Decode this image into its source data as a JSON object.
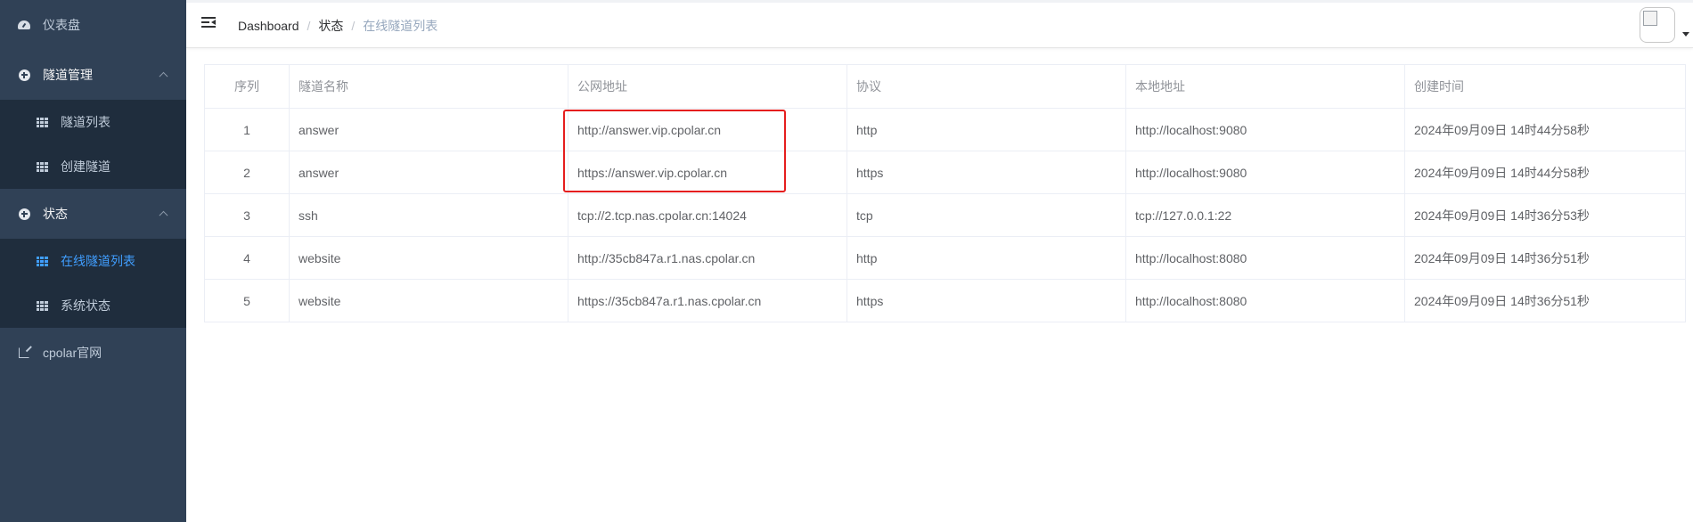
{
  "sidebar": {
    "items": [
      {
        "label": "仪表盘",
        "icon": "dashboard-icon"
      },
      {
        "label": "隧道管理",
        "icon": "tunnel-icon",
        "children": [
          {
            "label": "隧道列表",
            "icon": "table-icon"
          },
          {
            "label": "创建隧道",
            "icon": "table-icon"
          }
        ]
      },
      {
        "label": "状态",
        "icon": "status-icon",
        "children": [
          {
            "label": "在线隧道列表",
            "icon": "table-icon",
            "active": true
          },
          {
            "label": "系统状态",
            "icon": "table-icon"
          }
        ]
      },
      {
        "label": "cpolar官网",
        "icon": "external-link-icon"
      }
    ]
  },
  "header": {
    "breadcrumb": [
      "Dashboard",
      "状态",
      "在线隧道列表"
    ],
    "separator": "/"
  },
  "table": {
    "columns": [
      "序列",
      "隧道名称",
      "公网地址",
      "协议",
      "本地地址",
      "创建时间"
    ],
    "rows": [
      [
        "1",
        "answer",
        "http://answer.vip.cpolar.cn",
        "http",
        "http://localhost:9080",
        "2024年09月09日 14时44分58秒"
      ],
      [
        "2",
        "answer",
        "https://answer.vip.cpolar.cn",
        "https",
        "http://localhost:9080",
        "2024年09月09日 14时44分58秒"
      ],
      [
        "3",
        "ssh",
        "tcp://2.tcp.nas.cpolar.cn:14024",
        "tcp",
        "tcp://127.0.0.1:22",
        "2024年09月09日 14时36分53秒"
      ],
      [
        "4",
        "website",
        "http://35cb847a.r1.nas.cpolar.cn",
        "http",
        "http://localhost:8080",
        "2024年09月09日 14时36分51秒"
      ],
      [
        "5",
        "website",
        "https://35cb847a.r1.nas.cpolar.cn",
        "https",
        "http://localhost:8080",
        "2024年09月09日 14时36分51秒"
      ]
    ]
  },
  "colors": {
    "sidebar_bg": "#304156",
    "submenu_bg": "#1f2d3d",
    "active": "#409eff",
    "highlight_box": "#e51e1e"
  }
}
